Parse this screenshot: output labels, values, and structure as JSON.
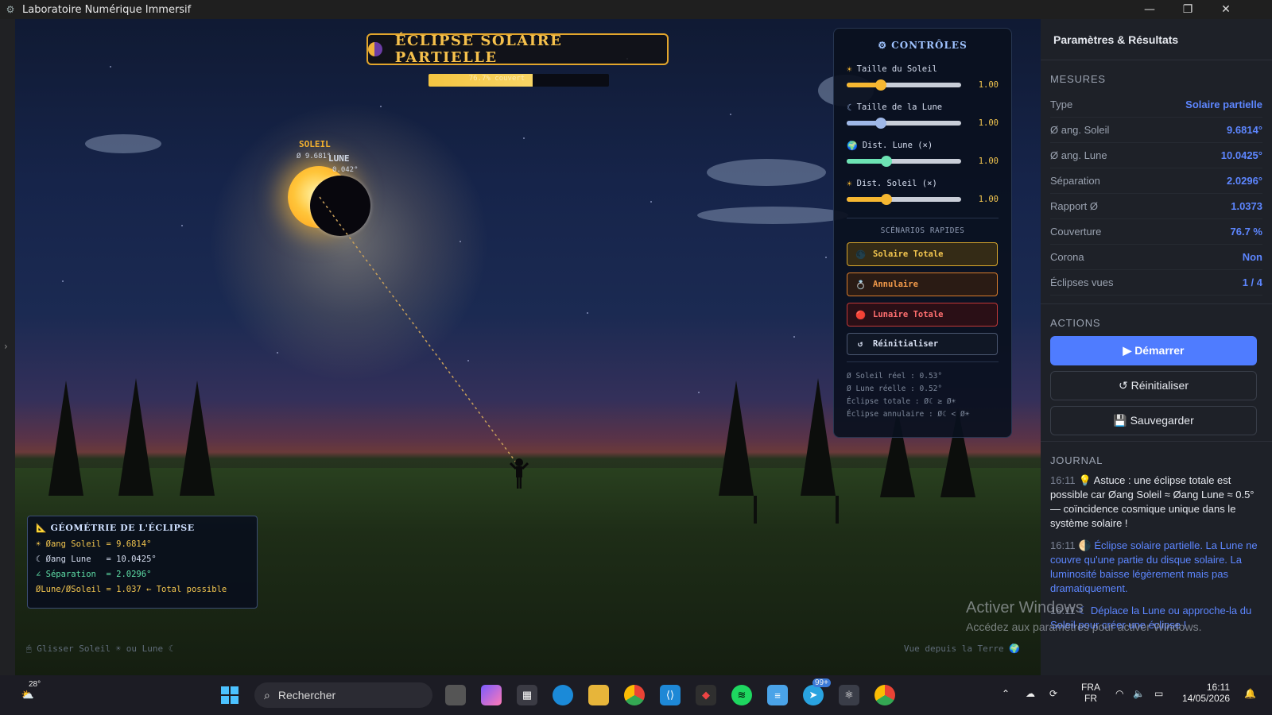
{
  "window": {
    "title": "Laboratoire Numérique Immersif",
    "controls": [
      "—",
      "❐",
      "✕"
    ]
  },
  "scene": {
    "banner_title": "ÉCLIPSE SOLAIRE PARTIELLE",
    "coverage_text": "76.7% couvert",
    "coverage_fraction": 0.767,
    "sun_label": "SOLEIL",
    "sun_sub": "Ø 9.681°",
    "moon_label": "LUNE",
    "moon_sub": "0.042°",
    "hint_left": "🖱 Glisser Soleil ☀ ou Lune ☾",
    "hint_right": "Vue depuis la Terre 🌍",
    "geometry": {
      "title": "📐 GÉOMÉTRIE DE L'ÉCLIPSE",
      "lines": [
        {
          "text": "☀ Øang Soleil = 9.6814°",
          "color": "#f3c64f"
        },
        {
          "text": "☾ Øang Lune   = 10.0425°",
          "color": "#d6def0"
        },
        {
          "text": "∠ Séparation  = 2.0296°",
          "color": "#5fe0a8"
        },
        {
          "text": "ØLune/ØSoleil = 1.037 ← Total possible",
          "color": "#f3c64f"
        }
      ]
    }
  },
  "controls": {
    "title": "⚙ CONTRÔLES",
    "sliders": [
      {
        "icon": "☀",
        "label": "Taille du Soleil",
        "value": "1.00",
        "fraction": 0.3,
        "color": "#f6b731"
      },
      {
        "icon": "☾",
        "label": "Taille de la Lune",
        "value": "1.00",
        "fraction": 0.3,
        "color": "#9fb8e8"
      },
      {
        "icon": "🌍",
        "label": "Dist. Lune (×)",
        "value": "1.00",
        "fraction": 0.35,
        "color": "#6de3b4"
      },
      {
        "icon": "☀",
        "label": "Dist. Soleil (×)",
        "value": "1.00",
        "fraction": 0.35,
        "color": "#f6b731"
      }
    ],
    "scenarios_title": "SCÉNARIOS RAPIDES",
    "scenarios": [
      {
        "icon": "🌑",
        "label": "Solaire Totale",
        "color": "#f3c64f",
        "border": "#d8a62c",
        "bg": "rgba(88,64,12,0.55)"
      },
      {
        "icon": "💍",
        "label": "Annulaire",
        "color": "#f39a4a",
        "border": "#d97c2c",
        "bg": "rgba(70,34,10,0.55)"
      },
      {
        "icon": "🔴",
        "label": "Lunaire Totale",
        "color": "#ff6f6f",
        "border": "#c13838",
        "bg": "rgba(70,12,12,0.55)"
      },
      {
        "icon": "↺",
        "label": "Réinitialiser",
        "color": "#d6def0",
        "border": "#4a5670",
        "bg": "rgba(20,26,40,0.6)"
      }
    ],
    "formulas": [
      "Ø Soleil réel : 0.53°",
      "Ø Lune réelle : 0.52°",
      "Éclipse totale : Ø☾ ≥ Ø☀",
      "Éclipse annulaire : Ø☾ < Ø☀"
    ]
  },
  "panel": {
    "title": "Paramètres & Résultats",
    "measures_head": "MESURES",
    "measures": [
      {
        "k": "Type",
        "v": "Solaire partielle"
      },
      {
        "k": "Ø ang. Soleil",
        "v": "9.6814°"
      },
      {
        "k": "Ø ang. Lune",
        "v": "10.0425°"
      },
      {
        "k": "Séparation",
        "v": "2.0296°"
      },
      {
        "k": "Rapport Ø",
        "v": "1.0373"
      },
      {
        "k": "Couverture",
        "v": "76.7 %"
      },
      {
        "k": "Corona",
        "v": "Non"
      },
      {
        "k": "Éclipses vues",
        "v": "1 / 4"
      }
    ],
    "actions_head": "ACTIONS",
    "start_label": "▶ Démarrer",
    "reset_label": "↺ Réinitialiser",
    "save_label": "💾 Sauvegarder",
    "journal_head": "JOURNAL",
    "journal": [
      {
        "time": "16:11",
        "text": "💡 Astuce : une éclipse totale est possible car Øang Soleil ≈ Øang Lune ≈ 0.5° — coïncidence cosmique unique dans le système solaire !",
        "style": "white"
      },
      {
        "time": "16:11",
        "text": "🌗 Éclipse solaire partielle. La Lune ne couvre qu'une partie du disque solaire. La luminosité baisse légèrement mais pas dramatiquement.",
        "style": "blue"
      },
      {
        "time": "16:11",
        "text": "☾ Déplace la Lune ou approche-la du Soleil pour créer une éclipse !",
        "style": "blue"
      }
    ]
  },
  "watermark": {
    "line1": "Activer Windows",
    "line2": "Accédez aux paramètres pour activer Windows."
  },
  "taskbar": {
    "weather": "28°",
    "search_placeholder": "Rechercher",
    "lang1": "FRA",
    "lang2": "FR",
    "time": "16:11",
    "date": "14/05/2026",
    "badge_telegram": "99+"
  }
}
